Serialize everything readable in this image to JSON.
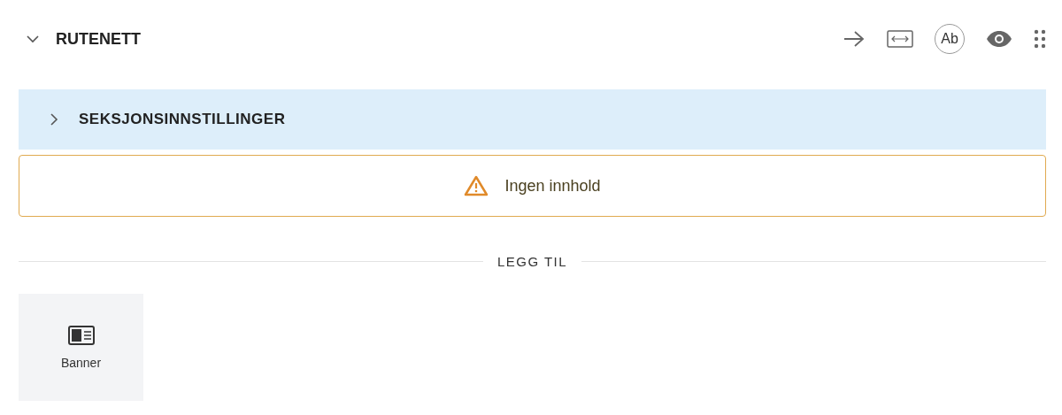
{
  "section": {
    "title": "RUTENETT",
    "expanded": true,
    "toolbar": {
      "text_button": "Ab"
    }
  },
  "settings": {
    "title": "SEKSJONSINNSTILLINGER",
    "expanded": false
  },
  "warning": {
    "text": "Ingen innhold"
  },
  "add": {
    "label": "LEGG TIL",
    "items": [
      {
        "label": "Banner",
        "kind": "banner"
      }
    ]
  }
}
